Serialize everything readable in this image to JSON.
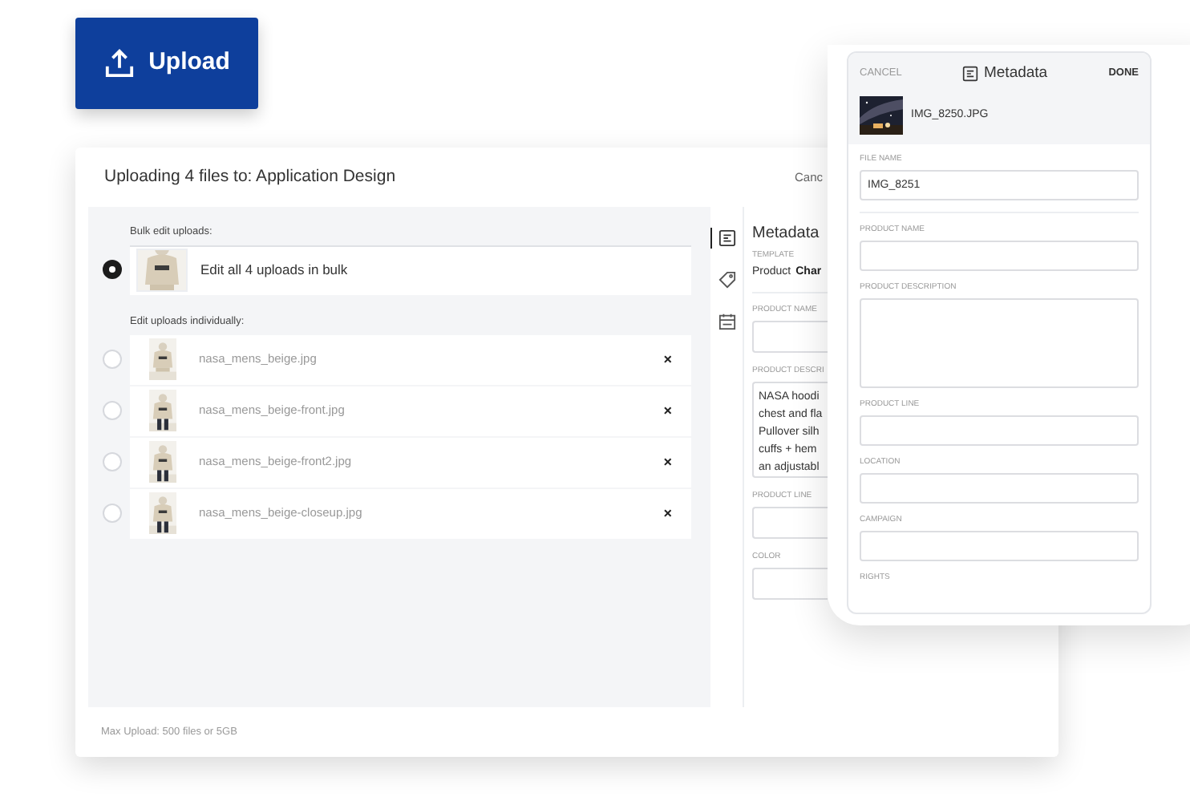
{
  "upload_button": {
    "label": "Upload"
  },
  "dialog": {
    "title": "Uploading 4 files to: Application Design",
    "cancel": "Canc",
    "bulk_heading": "Bulk edit uploads:",
    "bulk_item": {
      "label": "Edit all 4 uploads in bulk",
      "selected": true
    },
    "individual_heading": "Edit uploads individually:",
    "files": [
      {
        "name": "nasa_mens_beige.jpg",
        "selected": false,
        "remove": "×"
      },
      {
        "name": "nasa_mens_beige-front.jpg",
        "selected": false,
        "remove": "×"
      },
      {
        "name": "nasa_mens_beige-front2.jpg",
        "selected": false,
        "remove": "×"
      },
      {
        "name": "nasa_mens_beige-closeup.jpg",
        "selected": false,
        "remove": "×"
      }
    ],
    "side_tabs": [
      {
        "kind": "metadata",
        "selected": true
      },
      {
        "kind": "tags",
        "selected": false
      },
      {
        "kind": "schedule",
        "selected": false
      }
    ],
    "metadata": {
      "title": "Metadata",
      "template_label": "TEMPLATE",
      "template_value": "Product",
      "template_choice": "Char",
      "fields": [
        {
          "label": "PRODUCT NAME",
          "kind": "input"
        },
        {
          "label": "PRODUCT DESCRI",
          "kind": "textarea",
          "value": "NASA hoodi\nchest and fla\nPullover silh\ncuffs + hem\nan adjustabl"
        },
        {
          "label": "PRODUCT LINE",
          "kind": "input"
        },
        {
          "label": "COLOR",
          "kind": "input"
        }
      ]
    },
    "footer": "Max Upload: 500 files or 5GB"
  },
  "phone": {
    "cancel": "CANCEL",
    "title": "Metadata",
    "done": "DONE",
    "file_name": "IMG_8250.JPG",
    "fields": [
      {
        "label": "FILE NAME",
        "kind": "input",
        "value": "IMG_8251",
        "separated": true
      },
      {
        "label": "PRODUCT NAME",
        "kind": "input",
        "separated": false
      },
      {
        "label": "PRODUCT DESCRIPTION",
        "kind": "textarea",
        "separated": false
      },
      {
        "label": "PRODUCT LINE",
        "kind": "input",
        "separated": false
      },
      {
        "label": "LOCATION",
        "kind": "input",
        "separated": false
      },
      {
        "label": "CAMPAIGN",
        "kind": "input",
        "separated": false
      },
      {
        "label": "RIGHTS",
        "kind": "label",
        "separated": false
      }
    ]
  }
}
